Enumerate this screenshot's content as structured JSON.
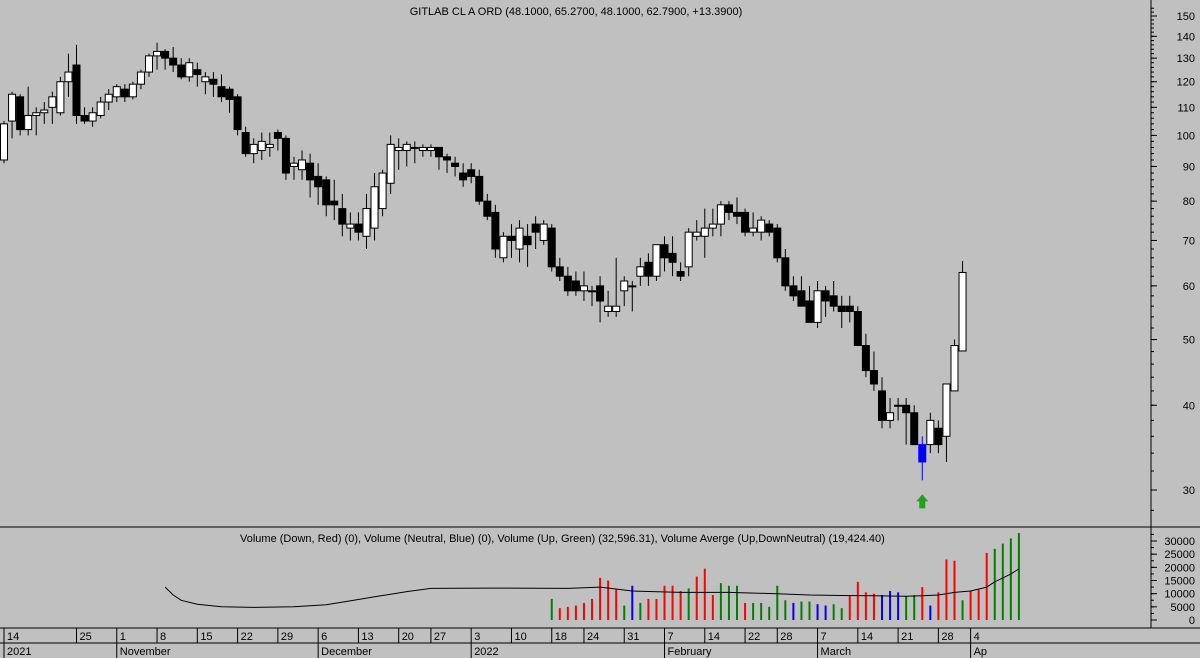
{
  "price_panel": {
    "title": "GITLAB CL A ORD (48.1000, 65.2700, 48.1000, 62.7900, +13.3900)"
  },
  "volume_panel": {
    "legend": "Volume (Down, Red) (0), Volume (Neutral, Blue) (0), Volume (Up, Green) (32,596.31), Volume Averge (Up,DownNeutral) (19,424.40)"
  },
  "colors": {
    "background": "#c0c0c0",
    "up_volume": "#008000",
    "down_volume": "#ff0000",
    "neutral_volume": "#0000ff",
    "highlight_candle": "#0000ff",
    "signal_arrow": "#20a020"
  },
  "icons": {
    "signal": "up-arrow-icon"
  },
  "chart_data": [
    {
      "type": "candlestick",
      "title": "GITLAB CL A ORD (48.1000, 65.2700, 48.1000, 62.7900, +13.3900)",
      "y_scale": "log",
      "ylim": [
        26,
        160
      ],
      "y_ticks": [
        30,
        40,
        50,
        60,
        70,
        80,
        90,
        100,
        110,
        120,
        130,
        140,
        150
      ],
      "ohlc": [
        [
          92,
          105,
          91,
          104
        ],
        [
          105,
          116,
          99,
          115
        ],
        [
          114,
          115,
          100,
          102
        ],
        [
          102,
          118,
          100,
          107
        ],
        [
          107,
          110,
          100,
          108
        ],
        [
          108,
          112,
          104,
          109
        ],
        [
          110,
          116,
          104,
          114
        ],
        [
          108,
          122,
          107,
          120
        ],
        [
          120,
          132,
          114,
          124
        ],
        [
          127,
          136,
          104,
          107
        ],
        [
          107,
          110,
          104,
          105
        ],
        [
          105,
          110,
          103,
          108
        ],
        [
          107,
          114,
          106,
          112
        ],
        [
          112,
          117,
          109,
          115
        ],
        [
          114,
          119,
          112,
          118
        ],
        [
          117,
          119,
          112,
          114
        ],
        [
          114,
          120,
          113,
          119
        ],
        [
          119,
          125,
          117,
          124
        ],
        [
          124,
          132,
          122,
          131
        ],
        [
          131,
          137,
          125,
          133
        ],
        [
          133,
          134,
          125,
          130
        ],
        [
          130,
          135,
          124,
          127
        ],
        [
          127,
          130,
          121,
          122
        ],
        [
          122,
          130,
          120,
          128
        ],
        [
          125,
          128,
          118,
          123
        ],
        [
          120,
          124,
          115,
          122
        ],
        [
          121,
          124,
          114,
          119
        ],
        [
          118,
          123,
          112,
          114
        ],
        [
          117,
          118,
          108,
          113
        ],
        [
          114,
          115,
          100,
          102
        ],
        [
          101,
          103,
          93,
          94
        ],
        [
          94,
          99,
          91,
          97
        ],
        [
          95,
          101,
          92,
          98
        ],
        [
          96,
          101,
          93,
          97
        ],
        [
          101,
          102,
          95,
          99
        ],
        [
          99,
          100,
          86,
          88
        ],
        [
          90,
          93,
          86,
          91
        ],
        [
          89,
          95,
          86,
          92
        ],
        [
          91,
          94,
          81,
          86
        ],
        [
          87,
          91,
          79,
          84
        ],
        [
          86,
          87,
          76,
          79
        ],
        [
          80,
          86,
          75,
          79
        ],
        [
          78,
          82,
          71,
          74
        ],
        [
          73,
          77,
          70,
          74
        ],
        [
          74,
          77,
          70,
          72
        ],
        [
          71,
          82,
          68,
          78
        ],
        [
          73,
          88,
          70,
          84
        ],
        [
          78,
          89,
          76,
          88
        ],
        [
          85,
          100,
          82,
          97
        ],
        [
          95,
          99,
          89,
          96
        ],
        [
          95,
          98,
          90,
          97
        ],
        [
          96,
          98,
          91,
          96
        ],
        [
          95,
          97,
          93,
          96
        ],
        [
          95,
          97,
          93,
          96
        ],
        [
          96,
          96,
          89,
          93
        ],
        [
          93,
          94,
          88,
          92
        ],
        [
          91,
          93,
          87,
          90
        ],
        [
          88,
          91,
          84,
          86
        ],
        [
          89,
          91,
          85,
          87
        ],
        [
          87,
          89,
          79,
          80
        ],
        [
          80,
          82,
          75,
          76
        ],
        [
          77,
          79,
          66,
          68
        ],
        [
          66,
          72,
          65,
          71
        ],
        [
          71,
          74,
          66,
          70
        ],
        [
          68,
          75,
          65,
          73
        ],
        [
          71,
          74,
          64,
          69
        ],
        [
          74,
          76,
          68,
          72
        ],
        [
          70,
          75,
          69,
          74
        ],
        [
          73,
          74,
          63,
          64
        ],
        [
          64,
          66,
          61,
          62
        ],
        [
          62,
          64,
          58,
          59
        ],
        [
          61,
          63,
          58,
          59
        ],
        [
          59,
          63,
          57,
          60
        ],
        [
          59,
          60,
          56,
          59
        ],
        [
          60,
          62,
          53,
          57
        ],
        [
          55,
          59,
          54,
          56
        ],
        [
          55,
          66,
          54,
          56
        ],
        [
          59,
          62,
          56,
          61
        ],
        [
          60,
          61,
          55,
          60
        ],
        [
          62,
          66,
          60,
          64
        ],
        [
          65,
          67,
          60,
          62
        ],
        [
          62,
          69,
          61,
          69
        ],
        [
          69,
          71,
          63,
          66
        ],
        [
          67,
          71,
          62,
          65
        ],
        [
          63,
          65,
          61,
          62
        ],
        [
          64,
          73,
          62,
          72
        ],
        [
          71,
          75,
          70,
          72
        ],
        [
          71,
          78,
          66,
          73
        ],
        [
          73,
          78,
          71,
          74
        ],
        [
          74,
          80,
          71,
          79
        ],
        [
          79,
          80,
          75,
          77
        ],
        [
          77,
          81,
          74,
          76
        ],
        [
          77,
          78,
          71,
          72
        ],
        [
          72,
          77,
          71,
          73
        ],
        [
          72,
          76,
          70,
          75
        ],
        [
          74,
          75,
          71,
          72
        ],
        [
          73,
          74,
          65,
          66
        ],
        [
          66,
          68,
          59,
          60
        ],
        [
          60,
          62,
          57,
          58
        ],
        [
          59,
          62,
          56,
          56
        ],
        [
          57,
          60,
          53,
          53
        ],
        [
          53,
          61,
          52,
          59
        ],
        [
          59,
          60,
          54,
          57
        ],
        [
          58,
          61,
          55,
          56
        ],
        [
          56,
          58,
          52,
          55
        ],
        [
          56,
          58,
          53,
          55
        ],
        [
          55,
          56,
          49,
          49
        ],
        [
          49,
          51,
          44,
          45
        ],
        [
          45,
          48,
          42,
          43
        ],
        [
          42,
          44,
          37,
          38
        ],
        [
          38,
          41,
          37,
          39
        ],
        [
          40,
          41,
          38,
          40
        ],
        [
          40,
          41,
          35,
          39
        ],
        [
          39,
          40,
          35,
          35
        ],
        [
          35,
          36,
          31,
          33
        ],
        [
          35,
          39,
          34,
          38
        ],
        [
          37,
          38,
          34,
          35
        ],
        [
          36,
          43,
          33,
          43
        ],
        [
          42,
          50,
          42,
          49
        ],
        [
          48.1,
          65.27,
          48.1,
          62.79
        ]
      ],
      "highlight_candle_index": 114,
      "signal_arrow_index": 114
    },
    {
      "type": "bar",
      "title": "Volume (Down, Red) (0), Volume (Neutral, Blue) (0), Volume (Up, Green) (32,596.31), Volume Averge (Up,DownNeutral) (19,424.40)",
      "ylim": [
        0,
        34000
      ],
      "y_ticks": [
        0,
        5000,
        10000,
        15000,
        20000,
        25000,
        30000
      ],
      "volume_bars": [
        {
          "i": 68,
          "v": 8000,
          "c": "up"
        },
        {
          "i": 69,
          "v": 4500,
          "c": "down"
        },
        {
          "i": 70,
          "v": 5000,
          "c": "down"
        },
        {
          "i": 71,
          "v": 5500,
          "c": "down"
        },
        {
          "i": 72,
          "v": 6500,
          "c": "down"
        },
        {
          "i": 73,
          "v": 8000,
          "c": "down"
        },
        {
          "i": 74,
          "v": 16000,
          "c": "down"
        },
        {
          "i": 75,
          "v": 15000,
          "c": "down"
        },
        {
          "i": 76,
          "v": 11500,
          "c": "down"
        },
        {
          "i": 77,
          "v": 5500,
          "c": "up"
        },
        {
          "i": 78,
          "v": 13000,
          "c": "neutral"
        },
        {
          "i": 79,
          "v": 6500,
          "c": "up"
        },
        {
          "i": 80,
          "v": 8000,
          "c": "down"
        },
        {
          "i": 81,
          "v": 8000,
          "c": "down"
        },
        {
          "i": 82,
          "v": 13000,
          "c": "down"
        },
        {
          "i": 83,
          "v": 13000,
          "c": "down"
        },
        {
          "i": 84,
          "v": 11000,
          "c": "down"
        },
        {
          "i": 85,
          "v": 12000,
          "c": "up"
        },
        {
          "i": 86,
          "v": 16500,
          "c": "down"
        },
        {
          "i": 87,
          "v": 19500,
          "c": "down"
        },
        {
          "i": 88,
          "v": 9500,
          "c": "down"
        },
        {
          "i": 89,
          "v": 14000,
          "c": "up"
        },
        {
          "i": 90,
          "v": 13000,
          "c": "up"
        },
        {
          "i": 91,
          "v": 13000,
          "c": "up"
        },
        {
          "i": 92,
          "v": 6500,
          "c": "down"
        },
        {
          "i": 93,
          "v": 6500,
          "c": "up"
        },
        {
          "i": 94,
          "v": 6500,
          "c": "up"
        },
        {
          "i": 95,
          "v": 5000,
          "c": "up"
        },
        {
          "i": 96,
          "v": 13000,
          "c": "up"
        },
        {
          "i": 97,
          "v": 7500,
          "c": "up"
        },
        {
          "i": 98,
          "v": 6500,
          "c": "neutral"
        },
        {
          "i": 99,
          "v": 7000,
          "c": "up"
        },
        {
          "i": 100,
          "v": 7000,
          "c": "up"
        },
        {
          "i": 101,
          "v": 6000,
          "c": "neutral"
        },
        {
          "i": 102,
          "v": 5500,
          "c": "neutral"
        },
        {
          "i": 103,
          "v": 6000,
          "c": "up"
        },
        {
          "i": 104,
          "v": 4500,
          "c": "up"
        },
        {
          "i": 105,
          "v": 9500,
          "c": "down"
        },
        {
          "i": 106,
          "v": 14500,
          "c": "down"
        },
        {
          "i": 107,
          "v": 10500,
          "c": "down"
        },
        {
          "i": 108,
          "v": 10000,
          "c": "down"
        },
        {
          "i": 109,
          "v": 9500,
          "c": "neutral"
        },
        {
          "i": 110,
          "v": 11000,
          "c": "neutral"
        },
        {
          "i": 111,
          "v": 10500,
          "c": "neutral"
        },
        {
          "i": 112,
          "v": 9000,
          "c": "up"
        },
        {
          "i": 113,
          "v": 9500,
          "c": "up"
        },
        {
          "i": 114,
          "v": 12500,
          "c": "down"
        },
        {
          "i": 115,
          "v": 5500,
          "c": "neutral"
        },
        {
          "i": 116,
          "v": 10500,
          "c": "down"
        },
        {
          "i": 117,
          "v": 23000,
          "c": "down"
        },
        {
          "i": 118,
          "v": 22500,
          "c": "down"
        },
        {
          "i": 119,
          "v": 7500,
          "c": "up"
        },
        {
          "i": 120,
          "v": 11000,
          "c": "down"
        },
        {
          "i": 121,
          "v": 11500,
          "c": "down"
        },
        {
          "i": 122,
          "v": 25500,
          "c": "down"
        },
        {
          "i": 123,
          "v": 27000,
          "c": "up"
        },
        {
          "i": 124,
          "v": 29000,
          "c": "up"
        },
        {
          "i": 125,
          "v": 31000,
          "c": "up"
        },
        {
          "i": 126,
          "v": 33000,
          "c": "up"
        }
      ],
      "average_line": [
        {
          "i": 20,
          "v": 12500
        },
        {
          "i": 21,
          "v": 9500
        },
        {
          "i": 22,
          "v": 7500
        },
        {
          "i": 24,
          "v": 6000
        },
        {
          "i": 27,
          "v": 5000
        },
        {
          "i": 31,
          "v": 4800
        },
        {
          "i": 36,
          "v": 5000
        },
        {
          "i": 40,
          "v": 5800
        },
        {
          "i": 42,
          "v": 6800
        },
        {
          "i": 44,
          "v": 7800
        },
        {
          "i": 46,
          "v": 8800
        },
        {
          "i": 48,
          "v": 9800
        },
        {
          "i": 50,
          "v": 10800
        },
        {
          "i": 53,
          "v": 12000
        },
        {
          "i": 60,
          "v": 12100
        },
        {
          "i": 70,
          "v": 12000
        },
        {
          "i": 74,
          "v": 12500
        },
        {
          "i": 78,
          "v": 11000
        },
        {
          "i": 84,
          "v": 10500
        },
        {
          "i": 90,
          "v": 10500
        },
        {
          "i": 96,
          "v": 10000
        },
        {
          "i": 100,
          "v": 9500
        },
        {
          "i": 104,
          "v": 9300
        },
        {
          "i": 108,
          "v": 9200
        },
        {
          "i": 112,
          "v": 9000
        },
        {
          "i": 114,
          "v": 9200
        },
        {
          "i": 116,
          "v": 9500
        },
        {
          "i": 118,
          "v": 10500
        },
        {
          "i": 120,
          "v": 11000
        },
        {
          "i": 122,
          "v": 12500
        },
        {
          "i": 123,
          "v": 14500
        },
        {
          "i": 124,
          "v": 16000
        },
        {
          "i": 125,
          "v": 17500
        },
        {
          "i": 126,
          "v": 19424
        }
      ]
    }
  ],
  "time_axis": {
    "day_ticks": [
      {
        "i": 0,
        "label": "14"
      },
      {
        "i": 9,
        "label": "25"
      },
      {
        "i": 14,
        "label": "1"
      },
      {
        "i": 19,
        "label": "8"
      },
      {
        "i": 24,
        "label": "15"
      },
      {
        "i": 29,
        "label": "22"
      },
      {
        "i": 34,
        "label": "29"
      },
      {
        "i": 39,
        "label": "6"
      },
      {
        "i": 44,
        "label": "13"
      },
      {
        "i": 49,
        "label": "20"
      },
      {
        "i": 53,
        "label": "27"
      },
      {
        "i": 58,
        "label": "3"
      },
      {
        "i": 63,
        "label": "10"
      },
      {
        "i": 68,
        "label": "18"
      },
      {
        "i": 72,
        "label": "24"
      },
      {
        "i": 77,
        "label": "31"
      },
      {
        "i": 82,
        "label": "7"
      },
      {
        "i": 87,
        "label": "14"
      },
      {
        "i": 92,
        "label": "22"
      },
      {
        "i": 96,
        "label": "28"
      },
      {
        "i": 101,
        "label": "7"
      },
      {
        "i": 106,
        "label": "14"
      },
      {
        "i": 111,
        "label": "21"
      },
      {
        "i": 116,
        "label": "28"
      },
      {
        "i": 120,
        "label": "4"
      }
    ],
    "period_labels": [
      {
        "i": 0,
        "label": "2021"
      },
      {
        "i": 14,
        "label": "November"
      },
      {
        "i": 39,
        "label": "December"
      },
      {
        "i": 58,
        "label": "2022"
      },
      {
        "i": 82,
        "label": "February"
      },
      {
        "i": 101,
        "label": "March"
      },
      {
        "i": 120,
        "label": "Ap"
      }
    ]
  }
}
